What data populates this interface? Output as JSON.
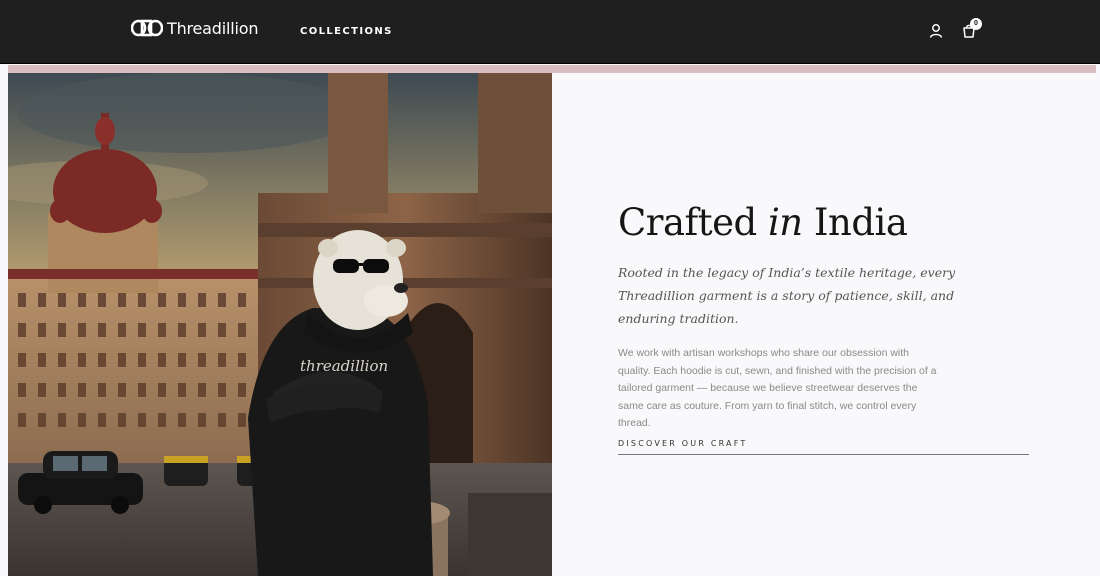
{
  "header": {
    "brand": "Threadillion",
    "nav_collections": "COLLECTIONS",
    "cart_count": "0",
    "icons": [
      "account-icon",
      "cart-icon"
    ]
  },
  "hero": {
    "image_alt": "Polar bear wearing sunglasses and a black threadillion hoodie in front of the Gateway of India and Taj Hotel, Mumbai",
    "hoodie_print": "threadillion"
  },
  "content": {
    "headline_pre": "Crafted ",
    "headline_em": "in",
    "headline_post": " India",
    "lead": "Rooted in the legacy of India’s textile heritage, every Threadillion garment is a story of patience, skill, and enduring tradition.",
    "body": "We work with artisan workshops who share our obsession with quality. Each hoodie is cut, sewn, and finished with the precision of a tailored garment — because we believe streetwear deserves the same care as couture. From yarn to final stitch, we control every thread.",
    "cta": "DISCOVER OUR CRAFT"
  },
  "colors": {
    "header_bg": "#1f1f1f",
    "accent_strip": "#d9bdbf",
    "panel_bg": "#f9f8fa"
  }
}
